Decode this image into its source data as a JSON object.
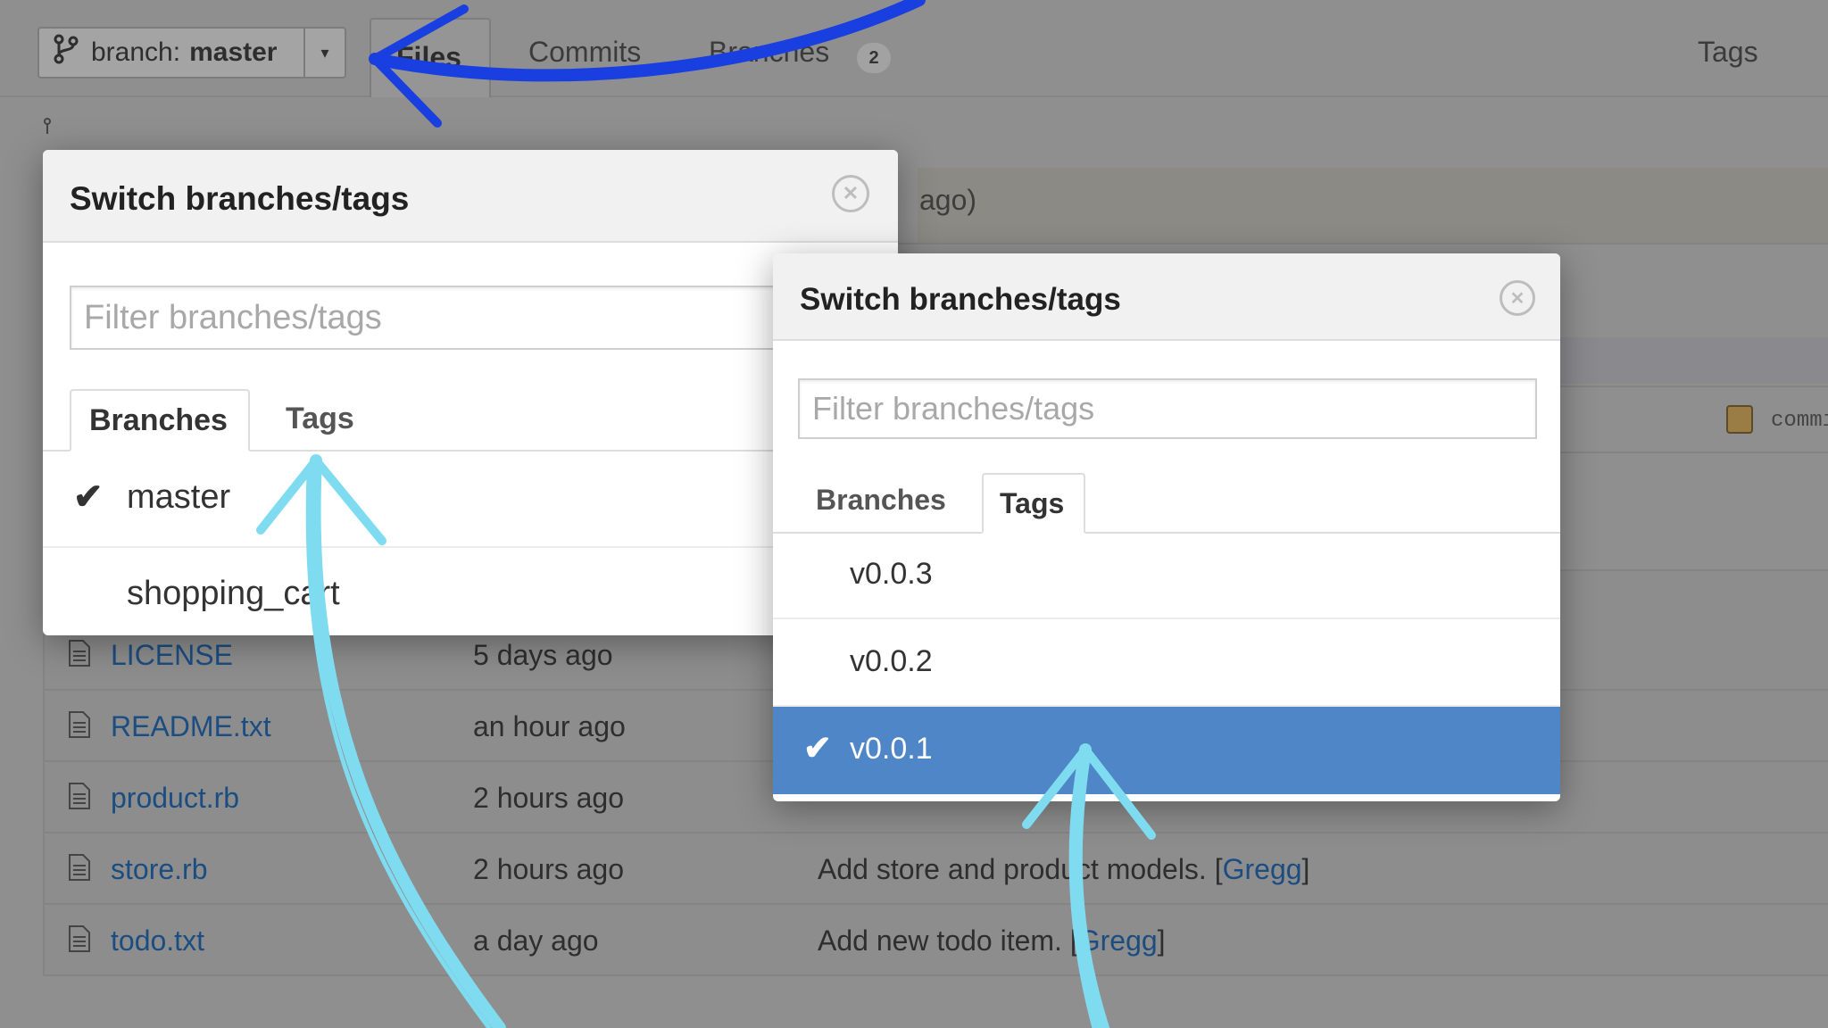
{
  "header": {
    "branch_button": {
      "label": "branch:",
      "value": "master",
      "icon": "branch-icon",
      "caret": "caret-down-icon"
    },
    "tabs": [
      {
        "label": "Files"
      },
      {
        "label": "Commits"
      },
      {
        "label": "Branches",
        "count": "2"
      }
    ],
    "tags_link": "Tags"
  },
  "background": {
    "last_commit_fragment": "ago)",
    "commit_fragment": "commi"
  },
  "files": [
    {
      "name": "LICENSE",
      "age": "5 days ago",
      "message": "",
      "author": ""
    },
    {
      "name": "README.txt",
      "age": "an hour ago",
      "message": "",
      "author": ""
    },
    {
      "name": "product.rb",
      "age": "2 hours ago",
      "message": "",
      "author": ""
    },
    {
      "name": "store.rb",
      "age": "2 hours ago",
      "message": "Add store and product models. [",
      "author": "Gregg",
      "tail": "]"
    },
    {
      "name": "todo.txt",
      "age": "a day ago",
      "message": "Add new todo item. [",
      "author": "Gregg",
      "tail": "]"
    }
  ],
  "popover_branches": {
    "title": "Switch branches/tags",
    "filter_placeholder": "Filter branches/tags",
    "tabs": {
      "branches": "Branches",
      "tags": "Tags"
    },
    "active_tab": "Branches",
    "items": [
      {
        "name": "master",
        "selected": true
      },
      {
        "name": "shopping_cart",
        "selected": false
      }
    ]
  },
  "popover_tags": {
    "title": "Switch branches/tags",
    "filter_placeholder": "Filter branches/tags",
    "tabs": {
      "branches": "Branches",
      "tags": "Tags"
    },
    "active_tab": "Tags",
    "items": [
      {
        "name": "v0.0.3",
        "selected": false
      },
      {
        "name": "v0.0.2",
        "selected": false
      },
      {
        "name": "v0.0.1",
        "selected": true
      }
    ]
  },
  "colors": {
    "selected_row": "#4e86c8",
    "link": "#1c4d80",
    "annotation_dark_blue": "#1a3fe0",
    "annotation_light_blue": "#7fdcf0"
  }
}
